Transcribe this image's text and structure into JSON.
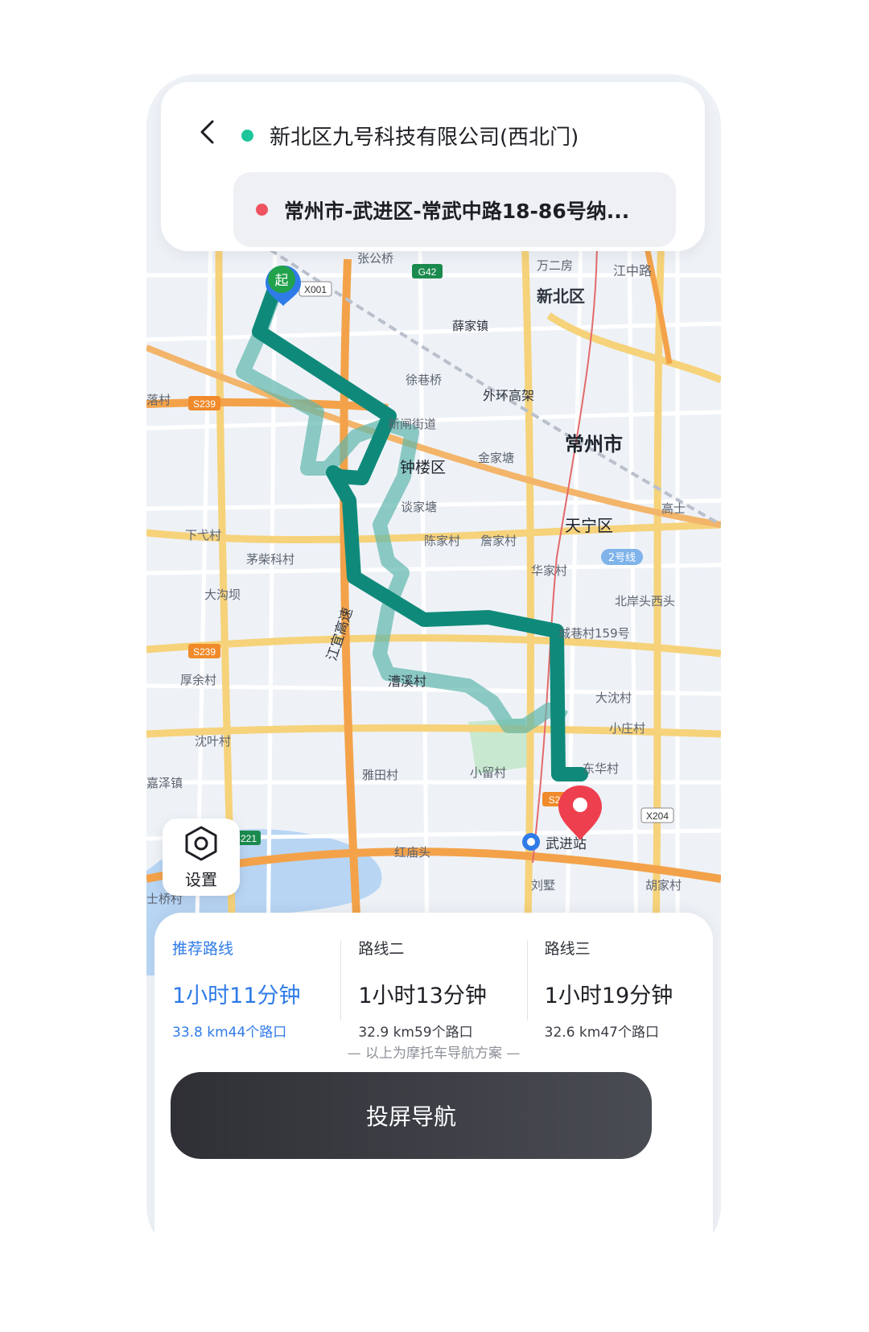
{
  "header": {
    "origin": "新北区九号科技有限公司(西北门)",
    "destination": "常州市-武进区-常武中路18-86号纳..."
  },
  "map": {
    "labels": {
      "zhanggongqiao": "张公桥",
      "wanerfang": "万二房",
      "xinbeiqu": "新北区",
      "jiangzhonglu": "江中路",
      "xuejiazhen": "薛家镇",
      "xuxiangqiao": "徐巷桥",
      "waihuangaojia": "外环高架",
      "xinzhajiedao": "新闸街道",
      "changzhoushi": "常州市",
      "zhongorlouqu": "钟楼区",
      "jinjiatang": "金家塘",
      "tanjiatang": "谈家塘",
      "tianningqu": "天宁区",
      "chenjiacun": "陈家村",
      "zhanjiacun": "詹家村",
      "huajiacun": "华家村",
      "xiagecun": "下弋村",
      "maochaikecun": "茅柴科村",
      "dagouba": "大沟坝",
      "beiantouxitou": "北岸头西头",
      "chengxiangcun": "城巷村159号",
      "houyucun": "厚余村",
      "jiangyigaosu": "江宜高速",
      "caoxicun": "漕溪村",
      "dashencun": "大沈村",
      "xiaozhuangcun": "小庄村",
      "shenyecun": "沈叶村",
      "jiazezhen": "嘉泽镇",
      "yatiancun": "雅田村",
      "xiaoliucun": "小留村",
      "donghuacun": "东华村",
      "hongmiaotou": "红庙头",
      "wujinzhan": "武进站",
      "liushu": "刘墅",
      "hujiacun": "胡家村",
      "shiqiaocun": "士桥村",
      "luocun": "落村",
      "gaoshi": "高士",
      "line2": "2号线",
      "start_marker": "起"
    },
    "road_shields": {
      "g42": "G42",
      "x001": "X001",
      "s239a": "S239",
      "s239b": "S239",
      "g4221": "G4221",
      "x204": "X204",
      "s2x": "S2"
    }
  },
  "settings": {
    "label": "设置"
  },
  "routes": [
    {
      "name": "推荐路线",
      "time": "1小时11分钟",
      "meta": "33.8 km44个路口",
      "active": true
    },
    {
      "name": "路线二",
      "time": "1小时13分钟",
      "meta": "32.9 km59个路口",
      "active": false
    },
    {
      "name": "路线三",
      "time": "1小时19分钟",
      "meta": "32.6 km47个路口",
      "active": false
    }
  ],
  "note": "— 以上为摩托车导航方案 —",
  "nav_button": "投屏导航",
  "colors": {
    "route_main": "#0f8a7a",
    "route_alt": "#5fb7ac",
    "accent_blue": "#2f7be8",
    "origin_dot": "#1dc59b",
    "dest_dot": "#f0525f"
  }
}
